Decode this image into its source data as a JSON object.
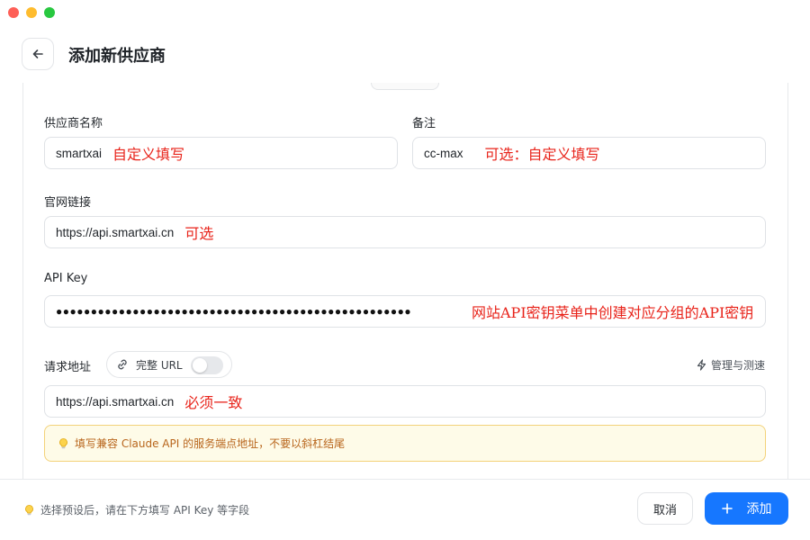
{
  "header": {
    "title": "添加新供应商"
  },
  "form": {
    "provider_name": {
      "label": "供应商名称",
      "value": "smartxai",
      "annotation": "自定义填写"
    },
    "remark": {
      "label": "备注",
      "value": "cc-max",
      "annotation": "可选：自定义填写"
    },
    "website": {
      "label": "官网链接",
      "value": "https://api.smartxai.cn",
      "annotation": "可选"
    },
    "api_key": {
      "label": "API Key",
      "masked_value": "●●●●●●●●●●●●●●●●●●●●●●●●●●●●●●●●●●●●●●●●●●●●●●●●●●●",
      "annotation": "网站API密钥菜单中创建对应分组的API密钥"
    },
    "request_url": {
      "label": "请求地址",
      "toggle_label": "完整 URL",
      "toggle_on": false,
      "manage_label": "管理与测速",
      "value": "https://api.smartxai.cn",
      "annotation": "必须一致"
    },
    "hint": "填写兼容 Claude API 的服务端点地址，不要以斜杠结尾"
  },
  "footer": {
    "hint": "选择预设后，请在下方填写 API Key 等字段",
    "cancel_label": "取消",
    "add_label": "添加"
  },
  "colors": {
    "primary": "#1677ff",
    "annotation": "#e8231a",
    "hint_text": "#b8651b",
    "hint_bg": "#fefbe8"
  }
}
